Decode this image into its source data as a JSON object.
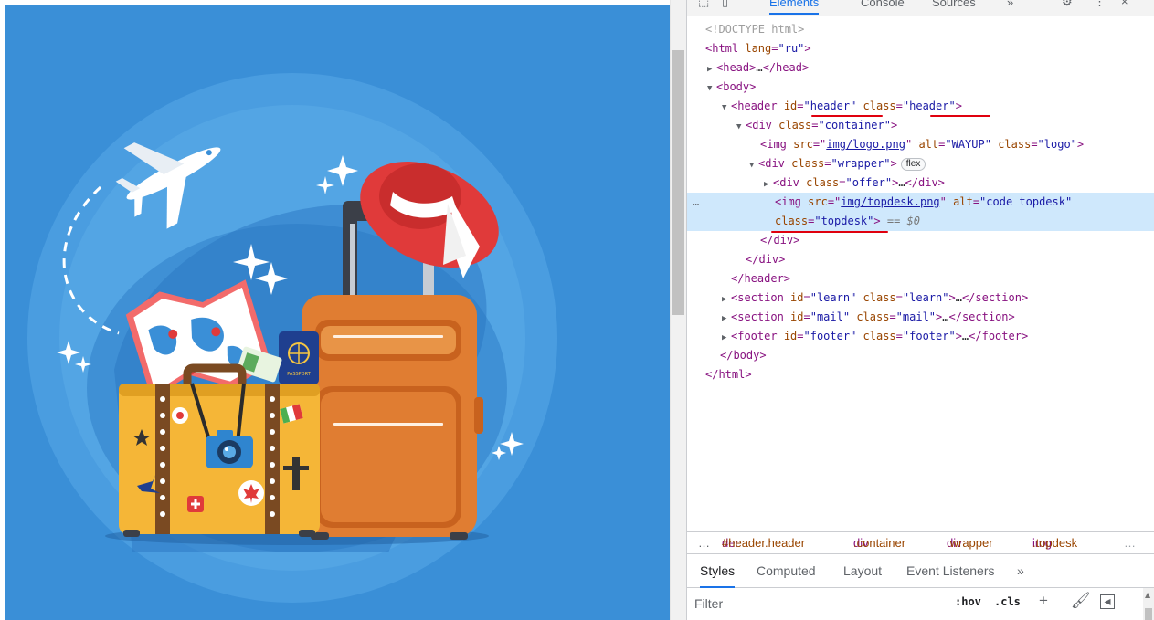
{
  "devtools": {
    "tabs": {
      "elements": "Elements",
      "console": "Console",
      "sources": "Sources",
      "more": "»"
    },
    "icons": [
      "inspect-element-icon",
      "device-toolbar-icon",
      "settings-icon",
      "more-vert-icon",
      "close-icon"
    ],
    "dom": {
      "doctype": "<!DOCTYPE html>",
      "lines": [
        {
          "tag_open": "<html",
          "attrs": [
            {
              "name": "lang",
              "value": "\"ru\""
            }
          ],
          "tag_close": ">"
        },
        {
          "tag_open": "<head>",
          "ellipsis": "…",
          "tag_end": "</head>"
        },
        {
          "tag_open": "<body>"
        },
        {
          "tag_open": "<header",
          "attrs": [
            {
              "name": "id",
              "value": "\"header\""
            },
            {
              "name": "class",
              "value": "\"header\""
            }
          ],
          "tag_close": ">"
        },
        {
          "tag_open": "<div",
          "attrs": [
            {
              "name": "class",
              "value": "\"container\""
            }
          ],
          "tag_close": ">"
        },
        {
          "tag_open": "<img",
          "src_attr": "src",
          "src_value": "img/logo.png",
          "attrs": [
            {
              "name": "alt",
              "value": "\"WAYUP\""
            },
            {
              "name": "class",
              "value": "\"logo\""
            }
          ],
          "tag_close": ">"
        },
        {
          "tag_open": "<div",
          "attrs": [
            {
              "name": "class",
              "value": "\"wrapper\""
            }
          ],
          "tag_close": ">",
          "badge": "flex"
        },
        {
          "tag_open": "<div",
          "attrs": [
            {
              "name": "class",
              "value": "\"offer\""
            }
          ],
          "tag_close": ">",
          "ellipsis": "…",
          "tag_end": "</div>"
        },
        {
          "tag_open": "<img",
          "src_attr": "src",
          "src_value": "img/topdesk.png",
          "attrs": [
            {
              "name": "alt",
              "value": "\"code topdesk\""
            }
          ]
        },
        {
          "attrs": [
            {
              "name": "class",
              "value": "\"topdesk\""
            }
          ],
          "tag_close": ">",
          "selected_marker": "== $0"
        },
        {
          "tag_end": "</div>"
        },
        {
          "tag_end": "</div>"
        },
        {
          "tag_end": "</header>"
        },
        {
          "tag_open": "<section",
          "attrs": [
            {
              "name": "id",
              "value": "\"learn\""
            },
            {
              "name": "class",
              "value": "\"learn\""
            }
          ],
          "tag_close": ">",
          "ellipsis": "…",
          "tag_end": "</section>"
        },
        {
          "tag_open": "<section",
          "attrs": [
            {
              "name": "id",
              "value": "\"mail\""
            },
            {
              "name": "class",
              "value": "\"mail\""
            }
          ],
          "tag_close": ">",
          "ellipsis": "…",
          "tag_end": "</section>"
        },
        {
          "tag_open": "<footer",
          "attrs": [
            {
              "name": "id",
              "value": "\"footer\""
            },
            {
              "name": "class",
              "value": "\"footer\""
            }
          ],
          "tag_close": ">",
          "ellipsis": "…",
          "tag_end": "</footer>"
        },
        {
          "tag_end": "</body>"
        },
        {
          "tag_end": "</html>"
        }
      ],
      "row_ellipsis": "…"
    },
    "breadcrumbs": {
      "lead": "…",
      "items": [
        {
          "tag": "der",
          "cls": "#header.header"
        },
        {
          "tag": "div",
          "cls": ".container"
        },
        {
          "tag": "div",
          "cls": ".wrapper"
        },
        {
          "tag": "img",
          "cls": ".topdesk"
        }
      ],
      "trail": "…"
    },
    "styles_tabs": [
      "Styles",
      "Computed",
      "Layout",
      "Event Listeners",
      "»"
    ],
    "filter": {
      "placeholder": "Filter",
      "hov": ":hov",
      "cls": ".cls",
      "new_rule": "+",
      "icons": [
        "paint-brush-icon",
        "toggle-sidebar-icon"
      ]
    }
  },
  "illustration": {
    "colors": {
      "background": "#3a8fd7",
      "suitcase_yellow": "#f5b637",
      "suitcase_orange": "#e07d32",
      "hat_red": "#e03a3a",
      "airplane": "#ffffff"
    },
    "stickers": [
      "airplane-icon",
      "hat-icon",
      "map-icon",
      "passport-icon",
      "camera-icon",
      "sparkle-icon"
    ],
    "passport_text": "PASSPORT"
  }
}
